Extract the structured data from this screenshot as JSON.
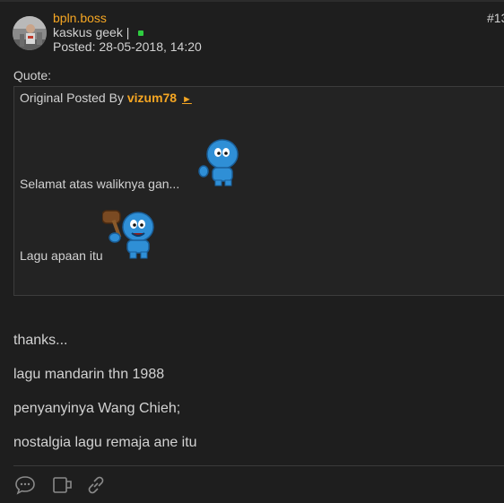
{
  "post": {
    "username": "bpln.boss",
    "rank": "kaskus geek |",
    "posted": "Posted: 28-05-2018, 14:20",
    "number": "#13"
  },
  "quote": {
    "label": "Quote:",
    "origin_prefix": "Original Posted By",
    "author": "vizum78",
    "arrow": "►",
    "line1": "Selamat atas waliknya gan...",
    "line2": "Lagu apaan itu"
  },
  "body": {
    "lines": [
      "thanks...",
      "lagu mandarin thn 1988",
      "penyanyinya Wang Chieh;",
      "nostalgia lagu remaja ane itu"
    ]
  },
  "actions": [
    {
      "icon": "comment-icon"
    },
    {
      "icon": "quote-reply-icon"
    },
    {
      "icon": "link-icon"
    }
  ],
  "colors": {
    "background": "#1e1e1e",
    "accent": "#f5a623",
    "online": "#2ecc40",
    "text": "#d2d2d2"
  }
}
